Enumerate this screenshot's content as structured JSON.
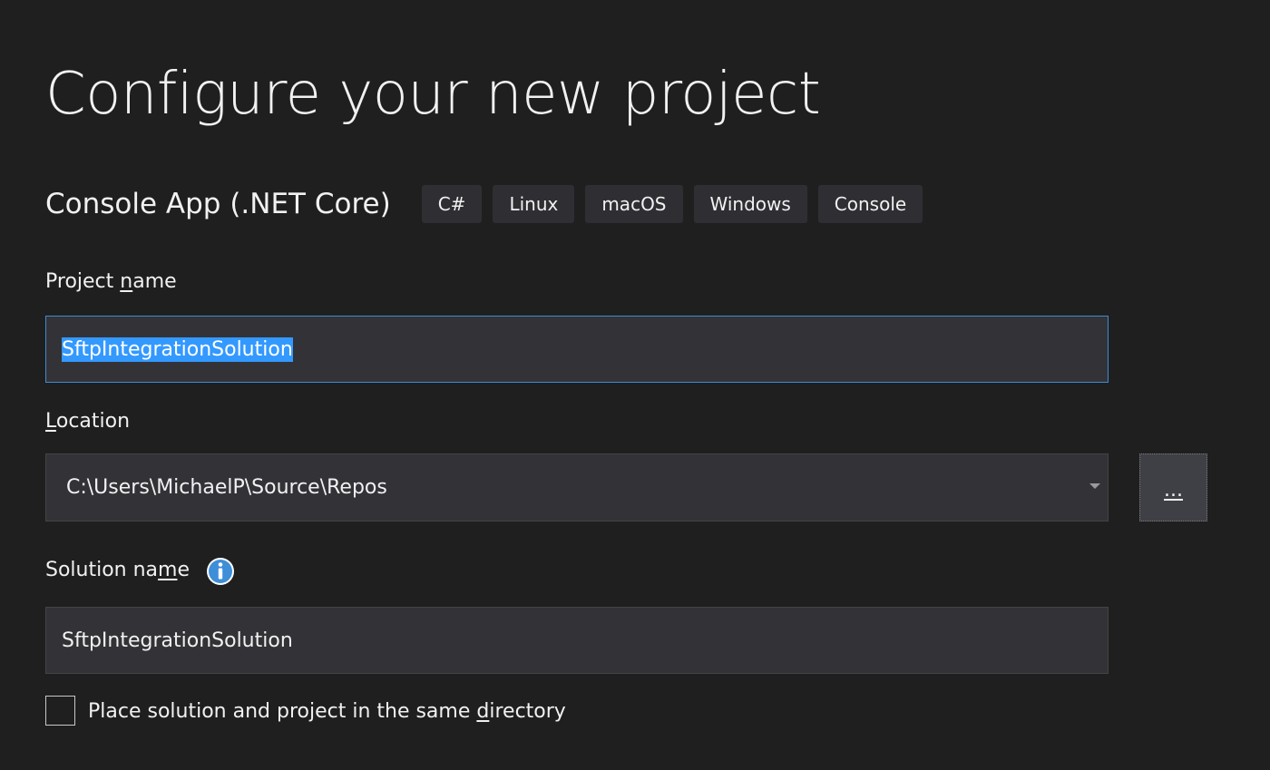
{
  "page_title": "Configure your new project",
  "template": {
    "name": "Console App (.NET Core)",
    "tags": [
      "C#",
      "Linux",
      "macOS",
      "Windows",
      "Console"
    ]
  },
  "project_name": {
    "label_before": "Project ",
    "label_accel": "n",
    "label_after": "ame",
    "value": "SftpIntegrationSolution",
    "text_selected": true
  },
  "location": {
    "label_accel": "L",
    "label_after": "ocation",
    "value": "C:\\Users\\MichaelP\\Source\\Repos",
    "browse_label": "..."
  },
  "solution_name": {
    "label_before": "Solution na",
    "label_accel": "m",
    "label_after": "e",
    "value": "SftpIntegrationSolution",
    "info_icon": "info-icon"
  },
  "same_directory": {
    "label_before": "Place solution and project in the same ",
    "label_accel": "d",
    "label_after": "irectory",
    "checked": false
  },
  "colors": {
    "background": "#1f1f20",
    "input_background": "#333337",
    "focus_border": "#3e8bd0",
    "selection": "#3399ff",
    "info_icon": "#3e8ed8"
  }
}
